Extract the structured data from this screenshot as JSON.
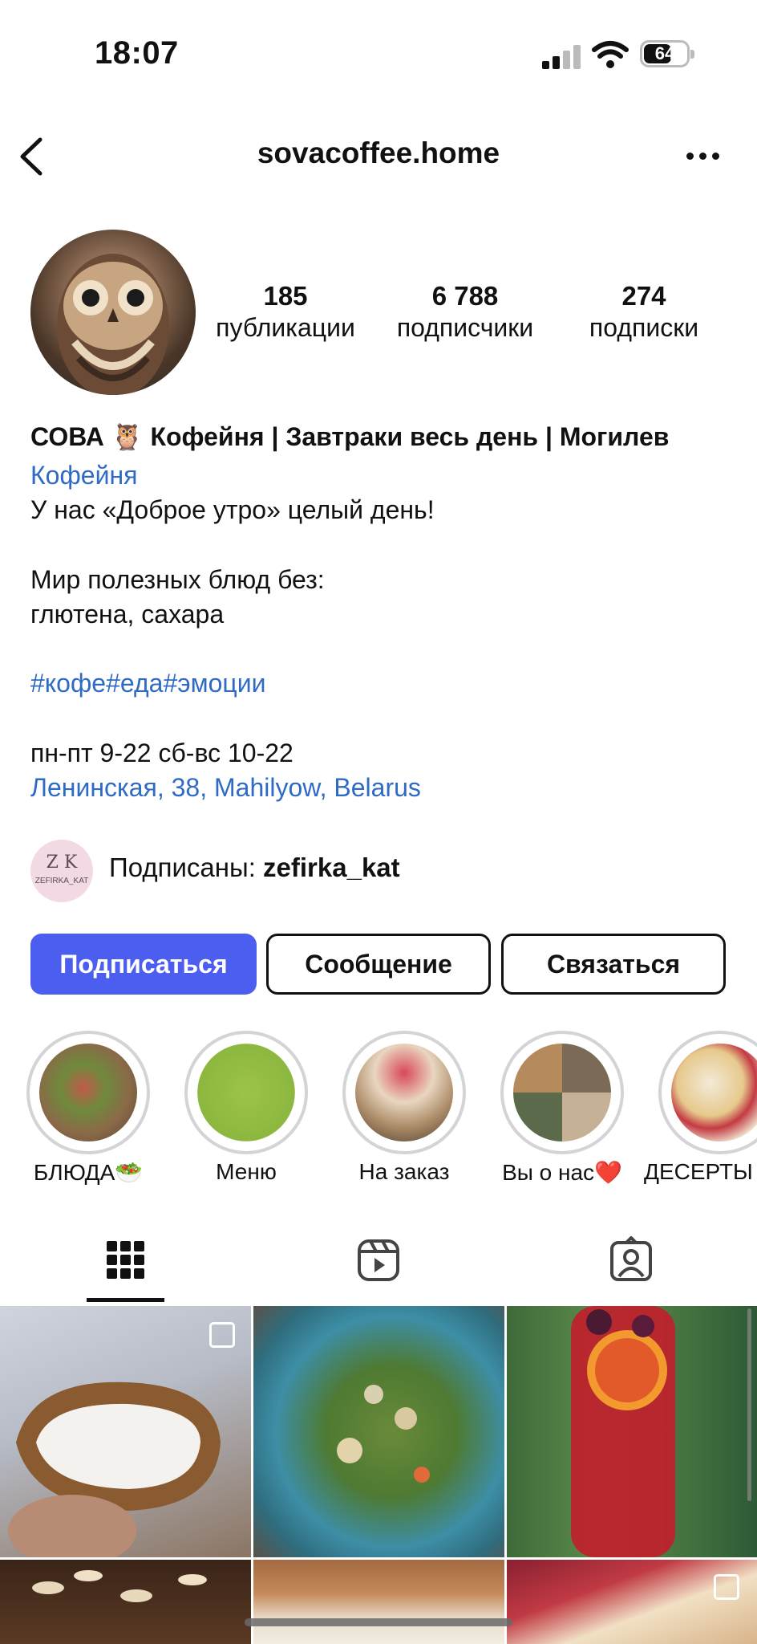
{
  "status_bar": {
    "time": "18:07",
    "battery": "64"
  },
  "header": {
    "username": "sovacoffee.home"
  },
  "stats": [
    {
      "value": "185",
      "label": "публикации"
    },
    {
      "value": "6 788",
      "label": "подписчики"
    },
    {
      "value": "274",
      "label": "подписки"
    }
  ],
  "bio": {
    "name": "СОВА 🦉 Кофейня | Завтраки весь день | Могилев",
    "category": "Кофейня",
    "line1": "У нас «Доброе утро» целый день!",
    "line2": "Мир полезных блюд без:",
    "line3": "глютена, сахара",
    "hashtags": "#кофе#еда#эмоции",
    "hours": "пн-пт 9-22 сб-вс 10-22",
    "address": "Ленинская, 38, Mahilyow, Belarus"
  },
  "mutual": {
    "prefix": "Подписаны: ",
    "account": "zefirka_kat",
    "avatar_letters": "Z K",
    "avatar_caption": "ZEFIRKA_KAT"
  },
  "buttons": {
    "follow": "Подписаться",
    "message": "Сообщение",
    "contact": "Связаться"
  },
  "highlights": [
    {
      "label": "БЛЮДА🥗"
    },
    {
      "label": "Меню"
    },
    {
      "label": "На заказ"
    },
    {
      "label": "Вы о нас❤️"
    },
    {
      "label": "ДЕСЕРТЫ"
    }
  ],
  "colors": {
    "accent": "#4b5ef0",
    "link": "#2f6bc4"
  }
}
